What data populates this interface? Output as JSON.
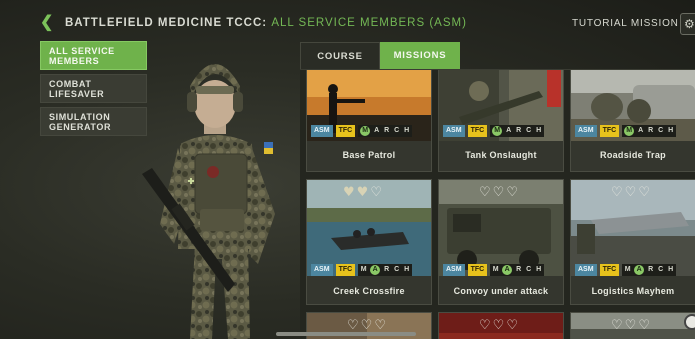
{
  "header": {
    "crumb": "BATTLEFIELD MEDICINE TCCC:",
    "current": "ALL SERVICE MEMBERS (ASM)",
    "tutorial_label": "TUTORIAL MISSION"
  },
  "menu": {
    "items": [
      {
        "label": "ALL SERVICE\nMEMBERS",
        "active": true
      },
      {
        "label": "COMBAT\nLIFESAVER",
        "active": false
      },
      {
        "label": "SIMULATION\nGENERATOR",
        "active": false
      }
    ]
  },
  "tabs": {
    "course": "COURSE",
    "missions": "MISSIONS"
  },
  "tags": {
    "asm": "ASM",
    "tfc": "TFC",
    "march": [
      "M",
      "A",
      "R",
      "C",
      "H"
    ]
  },
  "missions": [
    {
      "name": "Base Patrol",
      "march_done": "M"
    },
    {
      "name": "Tank Onslaught",
      "march_done": "M"
    },
    {
      "name": "Roadside Trap",
      "march_done": "M"
    },
    {
      "name": "Creek Crossfire",
      "march_done": "A",
      "hearts": [
        true,
        true,
        false
      ]
    },
    {
      "name": "Convoy under attack",
      "march_done": "A",
      "hearts": [
        false,
        false,
        false
      ]
    },
    {
      "name": "Logistics Mayhem",
      "march_done": "A",
      "hearts": [
        false,
        false,
        false
      ]
    }
  ],
  "colors": {
    "accent": "#6fb24b",
    "asm": "#4c86a0",
    "tfc": "#e7c21c"
  }
}
